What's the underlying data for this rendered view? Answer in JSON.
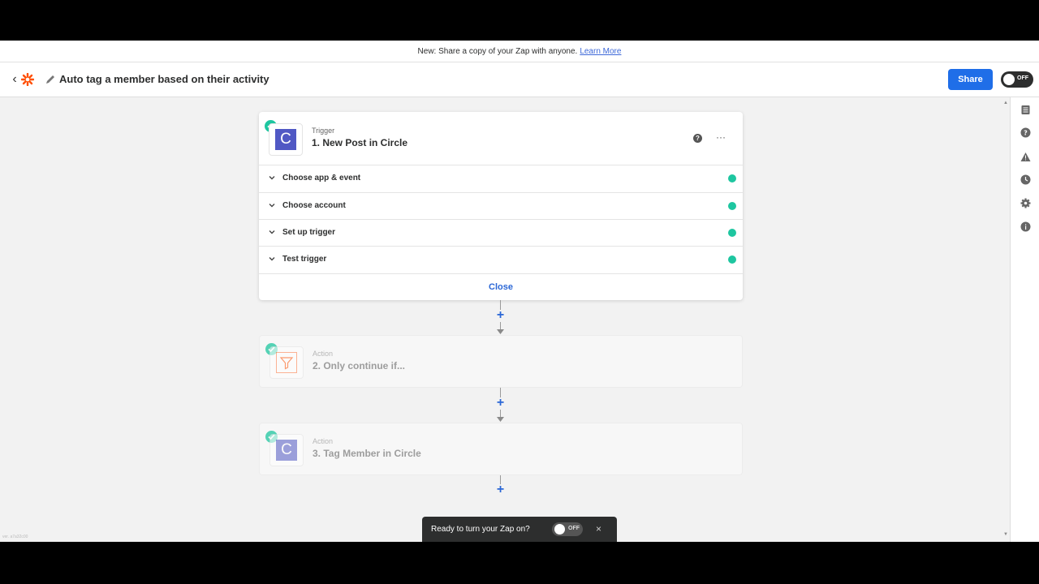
{
  "banner": {
    "text": "New: Share a copy of your Zap with anyone.",
    "link": "Learn More"
  },
  "header": {
    "title": "Auto tag a member based on their activity",
    "share_label": "Share",
    "toggle_label": "OFF"
  },
  "steps": [
    {
      "kind": "Trigger",
      "name": "1. New Post in Circle",
      "icon": "C",
      "rows": [
        {
          "label": "Choose app & event"
        },
        {
          "label": "Choose account"
        },
        {
          "label": "Set up trigger"
        },
        {
          "label": "Test trigger"
        }
      ],
      "close_label": "Close"
    },
    {
      "kind": "Action",
      "name": "2. Only continue if..."
    },
    {
      "kind": "Action",
      "name": "3. Tag Member in Circle",
      "icon": "C"
    }
  ],
  "toast": {
    "message": "Ready to turn your Zap on?",
    "toggle_label": "OFF",
    "close": "×"
  },
  "version": "ver. a7a32c00",
  "colors": {
    "accent": "#1f6ee8",
    "success": "#1ec6a0",
    "circle_brand": "#5058c4",
    "zapier_orange": "#ff4f00"
  },
  "icons": {
    "right_sidebar": [
      "outline-icon",
      "help-icon",
      "warning-icon",
      "history-icon",
      "settings-icon",
      "info-icon"
    ]
  }
}
